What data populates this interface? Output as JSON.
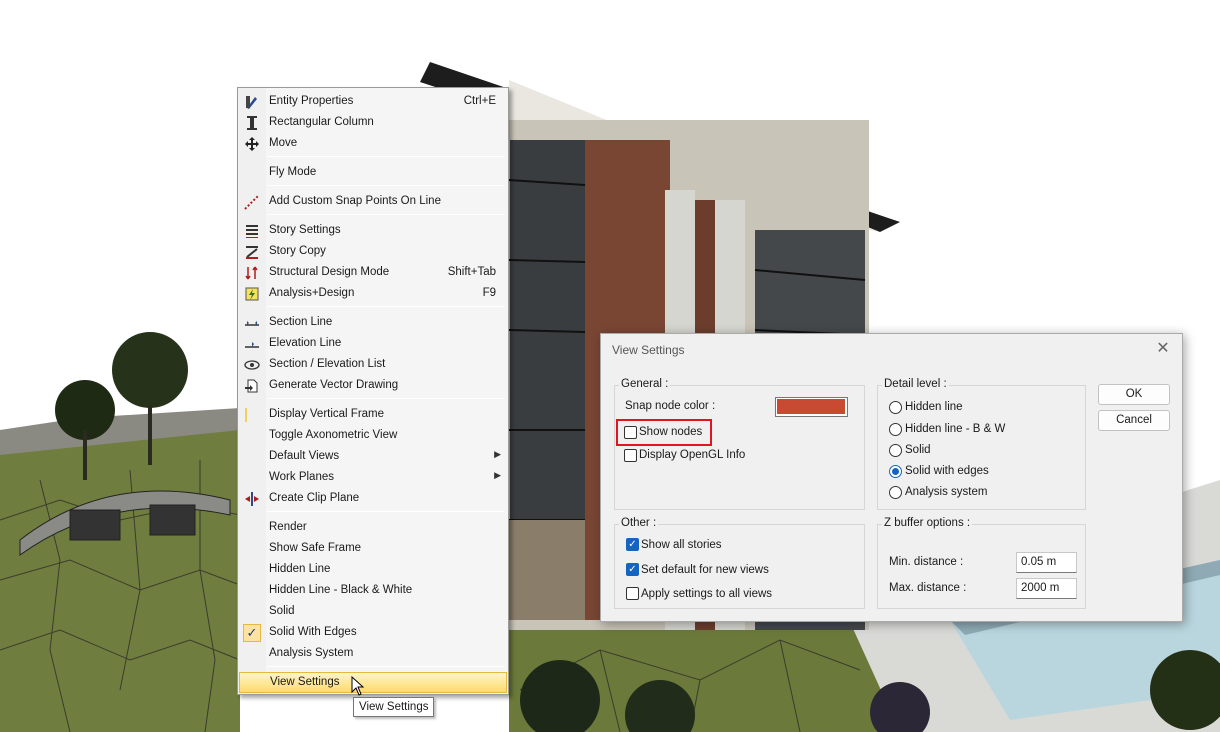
{
  "context_menu": {
    "items": [
      {
        "label": "Entity Properties",
        "shortcut": "Ctrl+E",
        "icon": "entity-properties-icon"
      },
      {
        "label": "Rectangular Column",
        "shortcut": "",
        "icon": "column-icon"
      },
      {
        "label": "Move",
        "shortcut": "",
        "icon": "move-icon"
      },
      {
        "label": "Fly Mode",
        "shortcut": "",
        "icon": ""
      },
      {
        "label": "Add Custom Snap Points On Line",
        "shortcut": "",
        "icon": "snap-points-icon"
      },
      {
        "label": "Story Settings",
        "shortcut": "",
        "icon": "story-settings-icon"
      },
      {
        "label": "Story Copy",
        "shortcut": "",
        "icon": "story-copy-icon"
      },
      {
        "label": "Structural Design Mode",
        "shortcut": "Shift+Tab",
        "icon": "structural-design-icon"
      },
      {
        "label": "Analysis+Design",
        "shortcut": "F9",
        "icon": "analysis-design-icon"
      },
      {
        "label": "Section Line",
        "shortcut": "",
        "icon": "section-line-icon"
      },
      {
        "label": "Elevation Line",
        "shortcut": "",
        "icon": "elevation-line-icon"
      },
      {
        "label": "Section / Elevation List",
        "shortcut": "",
        "icon": "eye-icon"
      },
      {
        "label": "Generate Vector Drawing",
        "shortcut": "",
        "icon": "vector-drawing-icon"
      },
      {
        "label": "Display Vertical Frame",
        "shortcut": "",
        "icon": "vertical-frame-icon"
      },
      {
        "label": "Toggle Axonometric View",
        "shortcut": "",
        "icon": ""
      },
      {
        "label": "Default Views",
        "shortcut": "",
        "icon": "",
        "submenu": true
      },
      {
        "label": "Work Planes",
        "shortcut": "",
        "icon": "",
        "submenu": true
      },
      {
        "label": "Create Clip Plane",
        "shortcut": "",
        "icon": "clip-plane-icon"
      },
      {
        "label": "Render",
        "shortcut": "",
        "icon": ""
      },
      {
        "label": "Show Safe Frame",
        "shortcut": "",
        "icon": ""
      },
      {
        "label": "Hidden Line",
        "shortcut": "",
        "icon": ""
      },
      {
        "label": "Hidden Line - Black & White",
        "shortcut": "",
        "icon": ""
      },
      {
        "label": "Solid",
        "shortcut": "",
        "icon": ""
      },
      {
        "label": "Solid With Edges",
        "shortcut": "",
        "icon": "checkmark-icon",
        "checked": true
      },
      {
        "label": "Analysis System",
        "shortcut": "",
        "icon": ""
      },
      {
        "label": "View Settings",
        "shortcut": "",
        "icon": "",
        "highlighted": true
      }
    ],
    "submenu_arrow": "▶",
    "check_glyph": "✓"
  },
  "tooltip": "View Settings",
  "dialog": {
    "title": "View Settings",
    "close_glyph": "✕",
    "general": {
      "title": "General :",
      "snap_node_color_label": "Snap node color :",
      "snap_node_color": "#c84a32",
      "show_nodes": {
        "label": "Show nodes",
        "checked": false
      },
      "display_opengl": {
        "label": "Display OpenGL Info",
        "checked": false
      }
    },
    "detail_level": {
      "title": "Detail level :",
      "options": [
        {
          "label": "Hidden line",
          "selected": false
        },
        {
          "label": "Hidden line - B & W",
          "selected": false
        },
        {
          "label": "Solid",
          "selected": false
        },
        {
          "label": "Solid with edges",
          "selected": true
        },
        {
          "label": "Analysis system",
          "selected": false
        }
      ]
    },
    "other": {
      "title": "Other :",
      "show_all_stories": {
        "label": "Show all stories",
        "checked": true
      },
      "set_default": {
        "label": "Set default for new views",
        "checked": true
      },
      "apply_all": {
        "label": "Apply settings to all views",
        "checked": false
      }
    },
    "z_buffer": {
      "title": "Z buffer options :",
      "min_label": "Min. distance :",
      "min_value": "0.05 m",
      "max_label": "Max. distance :",
      "max_value": "2000 m"
    },
    "ok_label": "OK",
    "cancel_label": "Cancel",
    "accent_color": "#1565c0",
    "highlight_color": "#e0161f"
  }
}
